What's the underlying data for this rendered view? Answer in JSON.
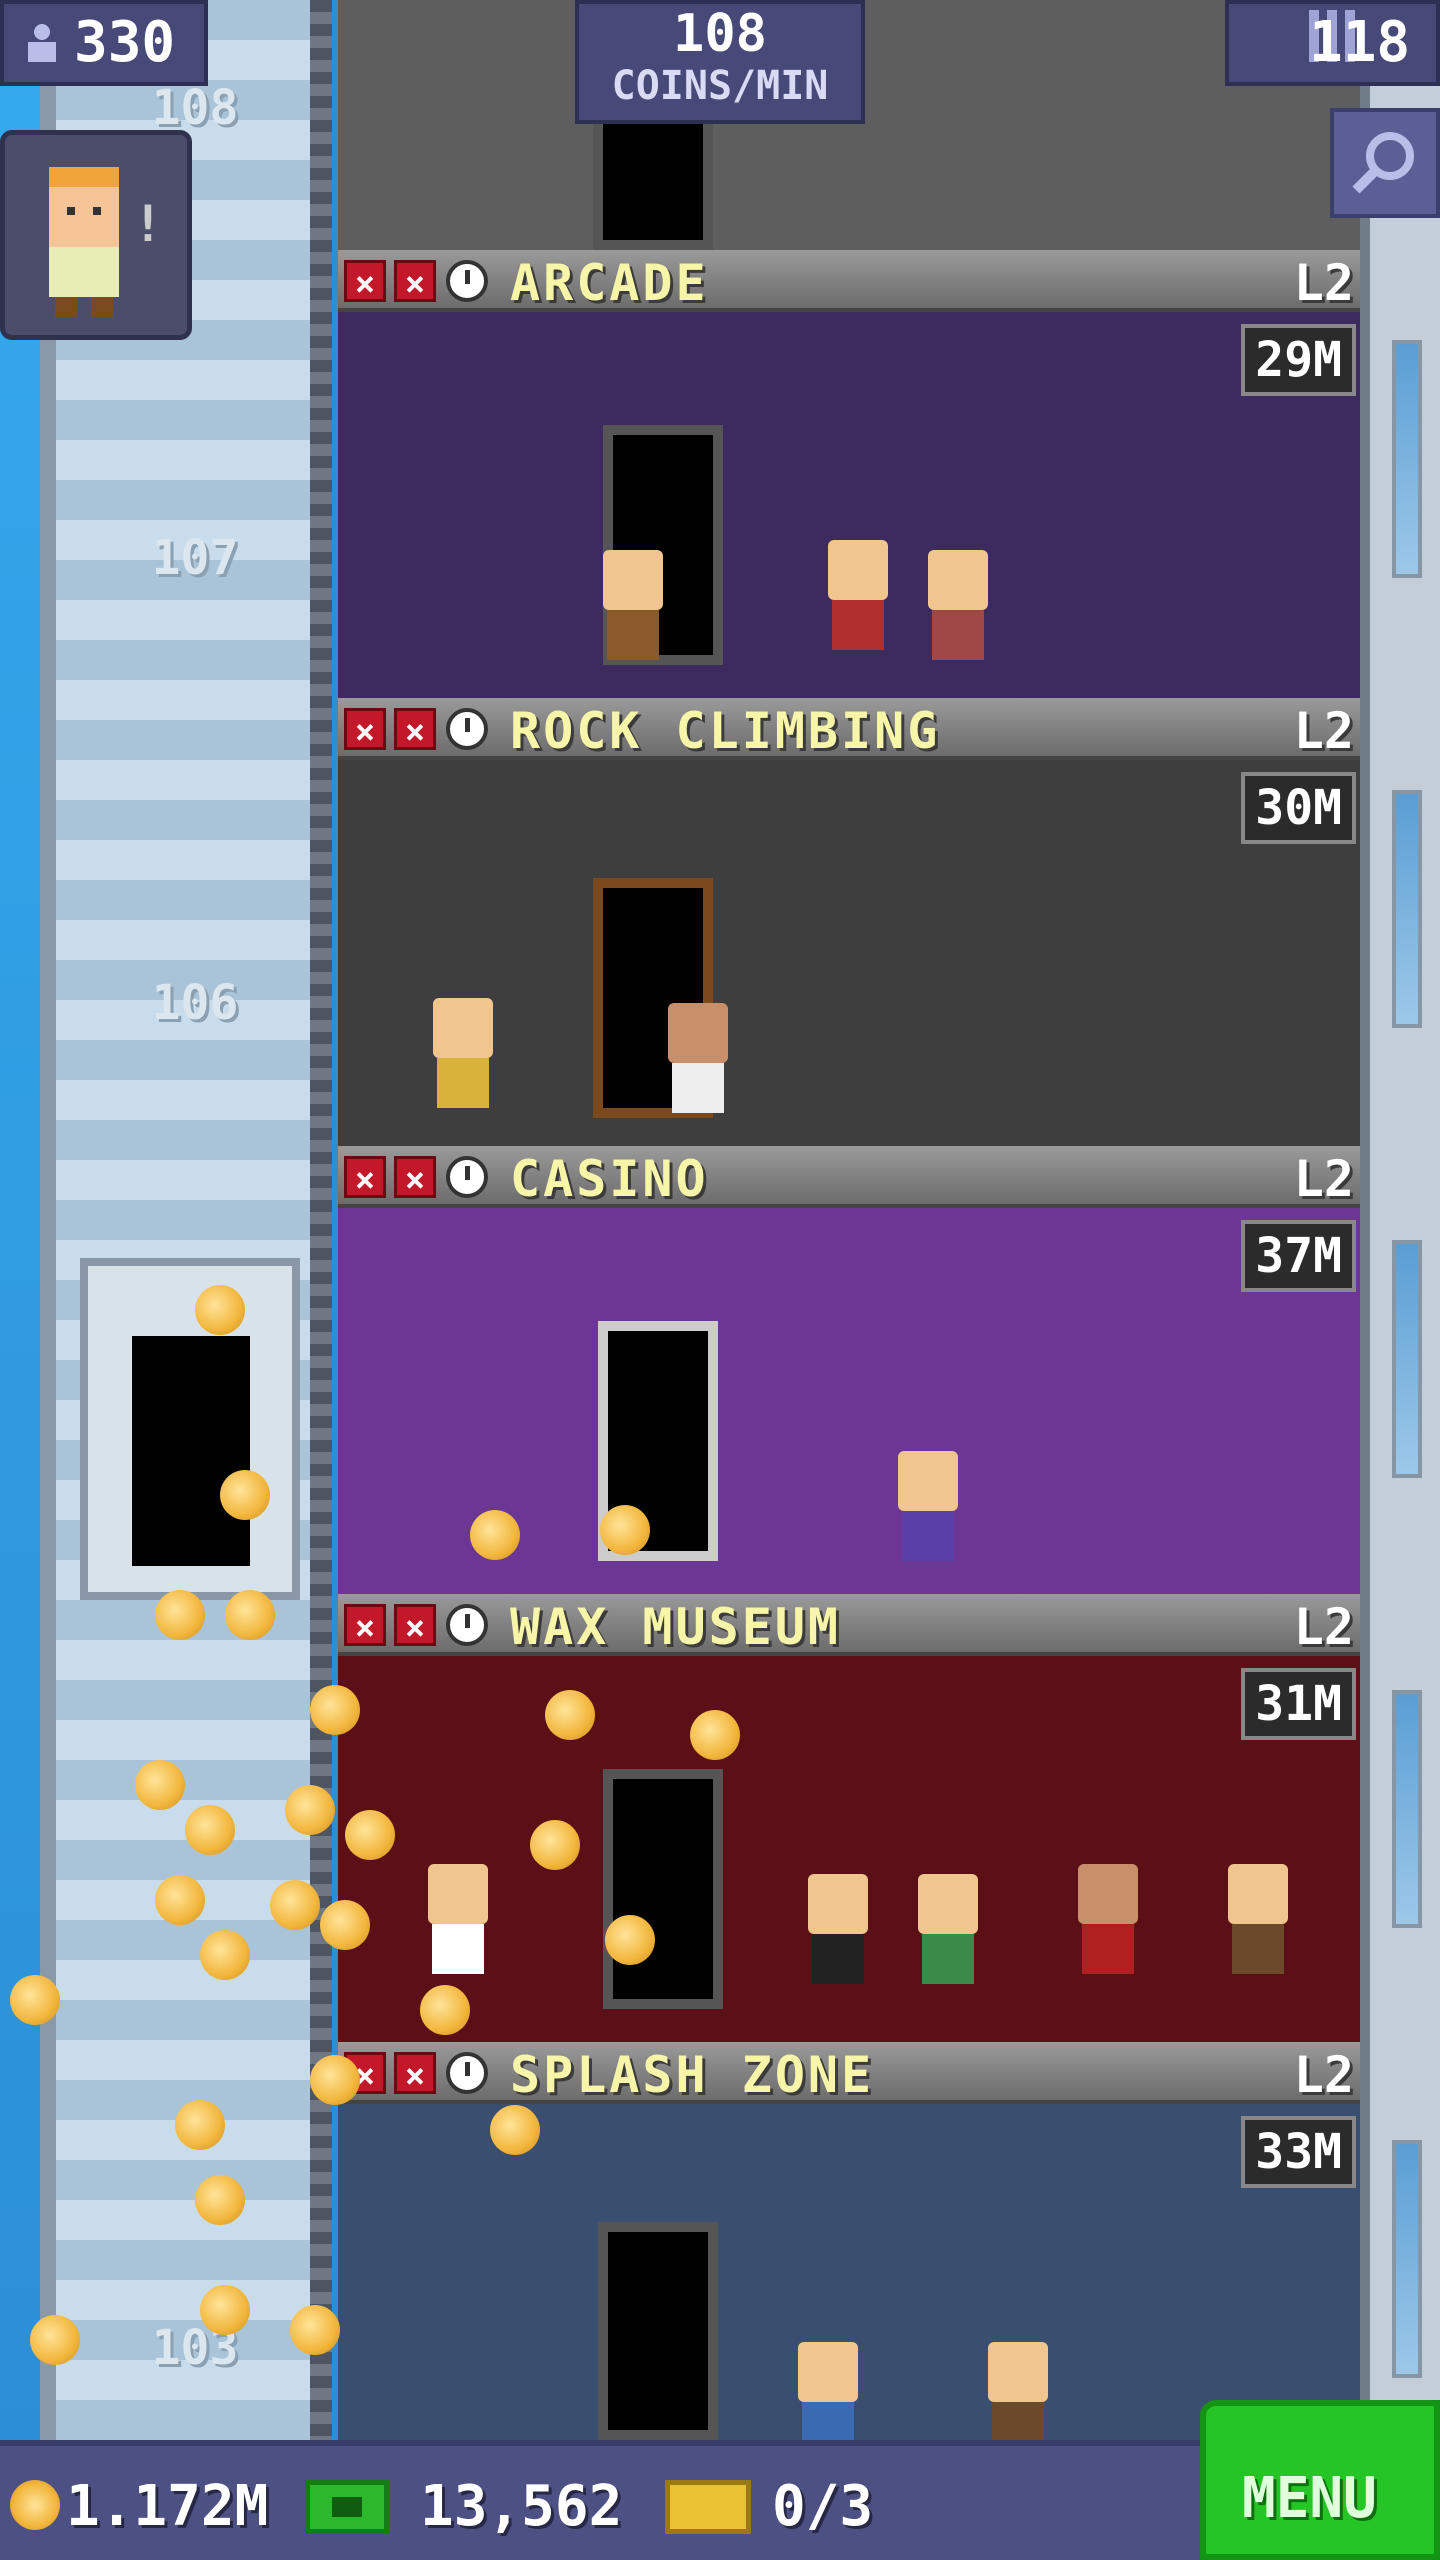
{
  "hud": {
    "population": "330",
    "coins_per_min_value": "108",
    "coins_per_min_label": "COINS/MIN",
    "tower_floors": "118"
  },
  "shaft_floor_numbers": [
    "108",
    "107",
    "106",
    "103"
  ],
  "floors": [
    {
      "name": "ARCADE",
      "level": "L2",
      "timer": "29M",
      "scene_color": "#3d2a5e"
    },
    {
      "name": "ROCK CLIMBING",
      "level": "L2",
      "timer": "30M",
      "scene_color": "#3e3e3e"
    },
    {
      "name": "CASINO",
      "level": "L2",
      "timer": "37M",
      "scene_color": "#6b3694"
    },
    {
      "name": "WAX MUSEUM",
      "level": "L2",
      "timer": "31M",
      "scene_color": "#5a1016"
    },
    {
      "name": "SPLASH ZONE",
      "level": "L2",
      "timer": "33M",
      "scene_color": "#3a4f70"
    }
  ],
  "bottom_bar": {
    "coins": "1.172M",
    "bux": "13,562",
    "tickets": "0/3",
    "menu_label": "MENU"
  },
  "icons": [
    "population-icon",
    "floor-grid-icon",
    "zoom-icon",
    "coin-icon",
    "bux-icon",
    "ticket-icon",
    "clock-icon",
    "x-icon"
  ]
}
